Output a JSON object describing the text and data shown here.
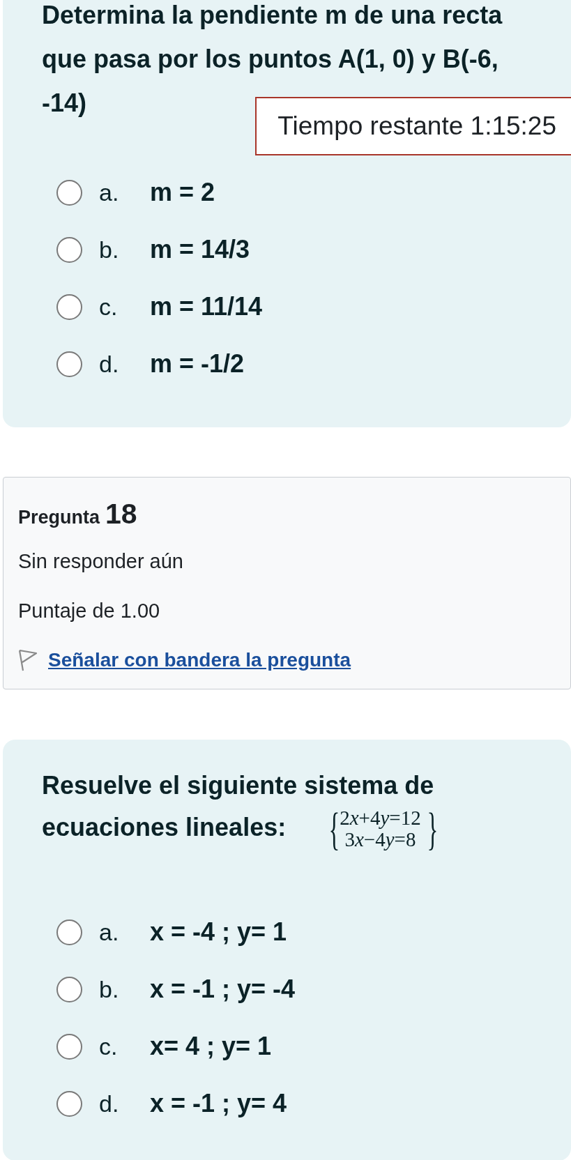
{
  "questions": [
    {
      "text": "Determina la pendiente m de una recta que pasa por los puntos A(1, 0) y B(-6, -14)",
      "options": [
        {
          "letter": "a.",
          "text": "m = 2",
          "selected": false
        },
        {
          "letter": "b.",
          "text": "m = 14/3",
          "selected": false
        },
        {
          "letter": "c.",
          "text": "m = 11/14",
          "selected": false
        },
        {
          "letter": "d.",
          "text": "m = -1/2",
          "selected": false
        }
      ]
    },
    {
      "info": {
        "label": "Pregunta",
        "number": "18",
        "status": "Sin responder aún",
        "grade": "Puntaje de 1.00",
        "flag_link": {
          "text": "Señalar con bandera la pregunta",
          "flagged": false
        }
      },
      "text": "Resuelve el siguiente sistema de ecuaciones lineales:",
      "equation_system": {
        "open": "{",
        "rows": [
          "2x+4y=12",
          "3x−4y=8"
        ],
        "close": "}"
      },
      "options": [
        {
          "letter": "a.",
          "text": "x = -4 ; y= 1",
          "selected": false
        },
        {
          "letter": "b.",
          "text": "x = -1 ; y= -4",
          "selected": false
        },
        {
          "letter": "c.",
          "text": "x= 4 ; y= 1",
          "selected": false
        },
        {
          "letter": "d.",
          "text": "x = -1 ; y= 4",
          "selected": false
        }
      ]
    }
  ],
  "timer": {
    "text": "Tiempo restante 1:15:25"
  }
}
